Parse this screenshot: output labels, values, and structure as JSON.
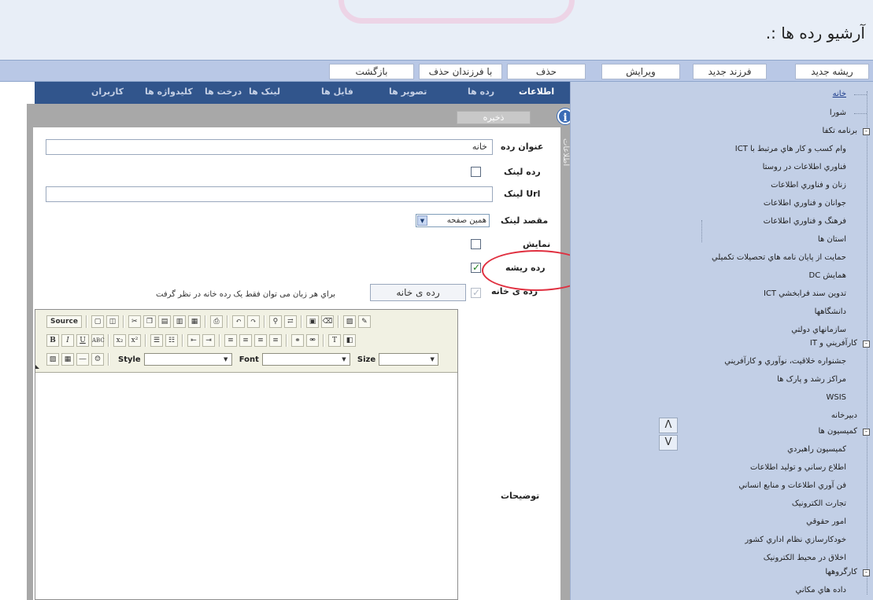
{
  "header": {
    "title": ".: آرشیو رده ها"
  },
  "toolbar": {
    "buttons": [
      "ریشه جدید",
      "فرزند جدید",
      "ویرایش",
      "حذف",
      "با فرزندان حذف",
      "بازگشت"
    ]
  },
  "tabs": [
    "اطلاعات",
    "رده ها",
    "تصویر ها",
    "فایل ها",
    "لینک ها",
    "درخت ها",
    "کلیدواژه ها",
    "کاربران"
  ],
  "panel": {
    "save_label": "ذخیره",
    "side_label": "اطلاعات"
  },
  "form": {
    "title_label": "عنوان رده",
    "title_value": "خانه",
    "link_category_label": "رده لینک",
    "url_label": "Url لینک",
    "url_value": "",
    "target_label": "مقصد لینک",
    "target_value": "همین صفحه",
    "display_label": "نمایش",
    "root_label": "رده ریشه",
    "home_label": "رده ی خانه",
    "home_button": "رده ی خانه",
    "home_note": "براي هر زبان می توان فقط یک رده خانه در نظر گرفت",
    "description_label": "توضیحات"
  },
  "editor": {
    "source_label": "Source",
    "bold": "B",
    "italic": "I",
    "underline": "U",
    "strike": "ABC",
    "style_label": "Style",
    "font_label": "Font",
    "size_label": "Size"
  },
  "tree": {
    "items": [
      "خانه",
      "شورا",
      "برنامه تکفا",
      "وام کسب و کار هاي مرتبط با ICT",
      "فناوري اطلاعات در روستا",
      "زنان و فناوري اطلاعات",
      "جوانان و فناوري اطلاعات",
      "فرهنگ و فناوري اطلاعات",
      "استان ها",
      "حمایت از پایان نامه هاي تحصیلات تکمیلي",
      "همایش DC",
      "تدوین سند فرابخشي ICT",
      "دانشگاهها",
      "سازمانهاي دولتي",
      "کارآفریني و IT",
      "جشنواره خلاقیت، نوآوري و کارآفریني",
      "مراکز رشد و پارک ها",
      "WSIS",
      "دبیرخانه",
      "کمیسیون ها",
      "کمیسیون راهبردي",
      "اطلاع رساني و تولید اطلاعات",
      "فن آوري اطلاعات و منابع انساني",
      "تجارت الکترونیک",
      "امور حقوقي",
      "خودکارسازي نظام اداري کشور",
      "اخلاق در محیط الکترونیک",
      "کارگروهها",
      "داده هاي مکاني"
    ],
    "expanders": [
      "-",
      "-",
      "-",
      "-"
    ],
    "up_arrow": "Λ",
    "down_arrow": "V"
  },
  "colors": {
    "tab_bar": "#31558c",
    "tree_panel": "#c2cfe6",
    "toolbar": "#b9c8e6",
    "annotation_circle": "#e03040"
  }
}
